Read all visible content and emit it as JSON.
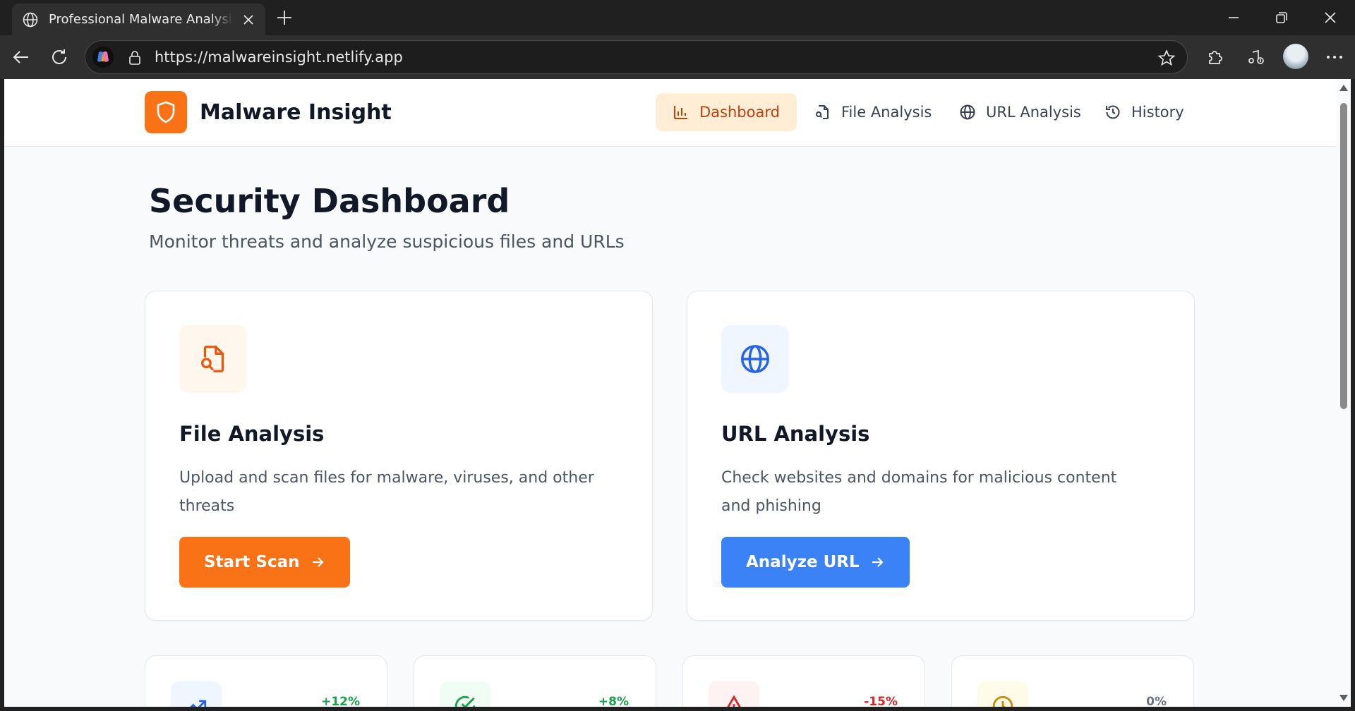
{
  "browser": {
    "tab_title": "Professional Malware Analysis App",
    "url": "https://malwareinsight.netlify.app"
  },
  "site": {
    "brand": "Malware Insight",
    "nav": [
      {
        "label": "Dashboard",
        "active": true
      },
      {
        "label": "File Analysis",
        "active": false
      },
      {
        "label": "URL Analysis",
        "active": false
      },
      {
        "label": "History",
        "active": false
      }
    ]
  },
  "page": {
    "title": "Security Dashboard",
    "subtitle": "Monitor threats and analyze suspicious files and URLs"
  },
  "cards": [
    {
      "title": "File Analysis",
      "description": "Upload and scan files for malware, viruses, and other threats",
      "button": "Start Scan",
      "icon": "file-search-icon"
    },
    {
      "title": "URL Analysis",
      "description": "Check websites and domains for malicious content and phishing",
      "button": "Analyze URL",
      "icon": "globe-icon"
    }
  ],
  "stats": [
    {
      "change": "+12%",
      "icon": "trending-up-icon"
    },
    {
      "change": "+8%",
      "icon": "check-circle-icon"
    },
    {
      "change": "-15%",
      "icon": "alert-triangle-icon"
    },
    {
      "change": "0%",
      "icon": "clock-icon"
    }
  ],
  "colors": {
    "brand_orange": "#f97316",
    "primary_blue": "#3b82f6",
    "nav_active_bg": "#ffedd5",
    "nav_active_text": "#c2410c"
  }
}
